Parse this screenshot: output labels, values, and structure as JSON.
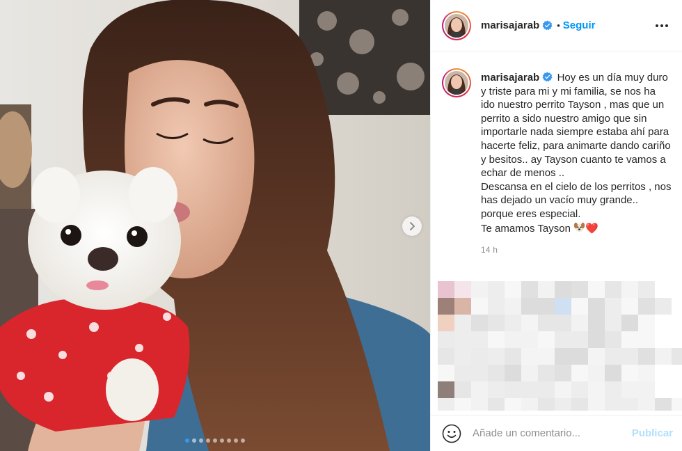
{
  "post": {
    "username": "marisajarab",
    "verified": true,
    "follow_label": "Seguir",
    "separator": "•",
    "more_icon": "more-horizontal-icon"
  },
  "caption": {
    "username": "marisajarab",
    "text": "Hoy es un día muy duro y triste para mi y mi familia, se nos ha ido nuestro perrito Tayson , mas que un perrito a sido nuestro amigo que sin importarle nada siempre estaba ahí para hacerte feliz, para animarte dando cariño y besitos.. ay Tayson cuanto te vamos a echar de menos ..\nDescansa en el cielo de los perritos , nos has dejado un vacío muy grande.. porque eres especial.\nTe amamos Tayson",
    "emojis": [
      "dog-face-emoji",
      "red-heart-emoji"
    ],
    "heart": "❤️",
    "timestamp": "14 h"
  },
  "carousel": {
    "slide_count": 9,
    "active_index": 0,
    "next_icon": "chevron-right-icon"
  },
  "comments": {
    "placeholder": "Añade un comentario...",
    "publish_label": "Publicar",
    "emoji_icon": "smiley-icon"
  },
  "colors": {
    "accent": "#0095f6",
    "publish_disabled": "#b2dffc",
    "verified": "#3897f0",
    "border": "#efefef",
    "muted": "#8e8e8e"
  }
}
